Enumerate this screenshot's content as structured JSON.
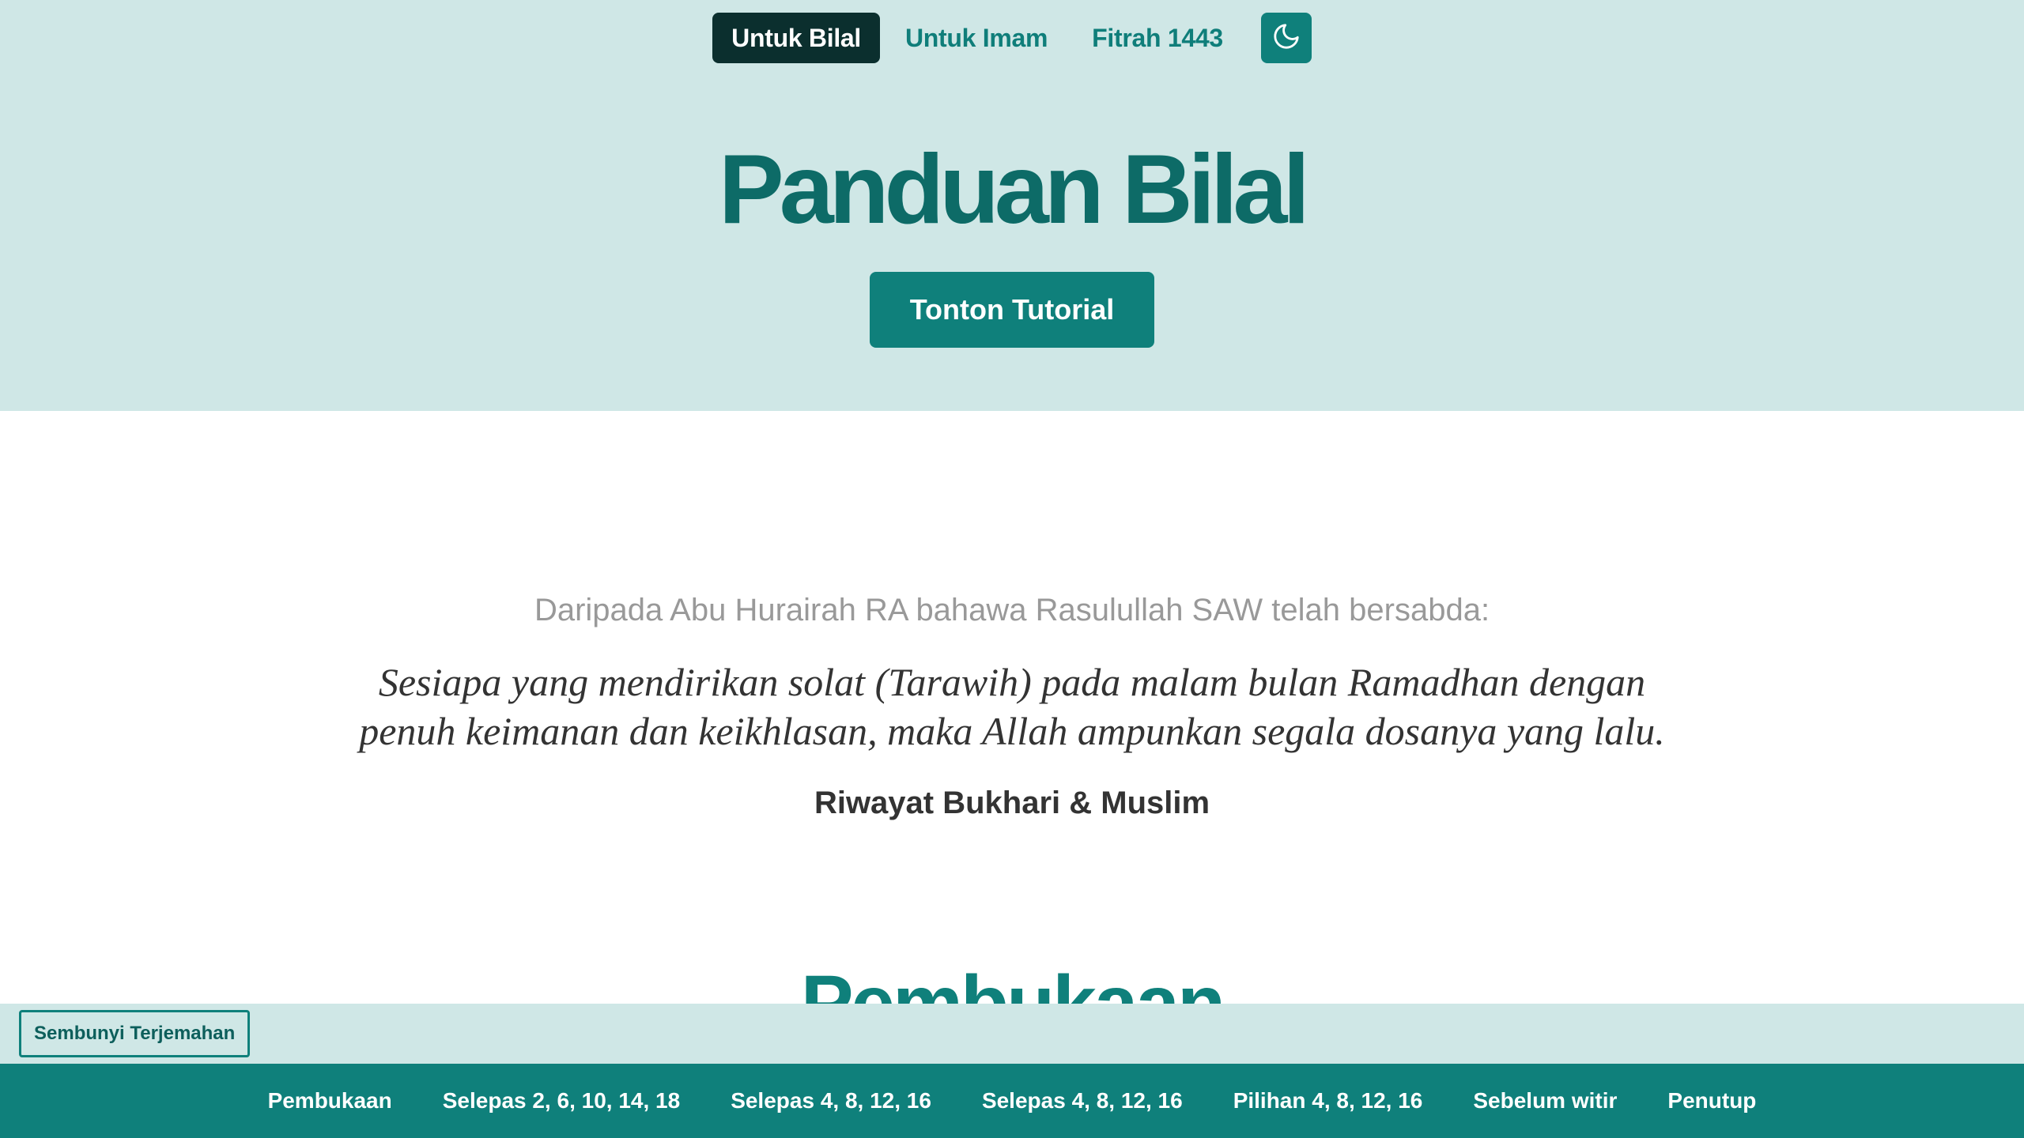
{
  "topnav": {
    "items": [
      {
        "label": "Untuk Bilal",
        "active": true
      },
      {
        "label": "Untuk Imam",
        "active": false
      },
      {
        "label": "Fitrah 1443",
        "active": false
      }
    ],
    "theme_toggle_icon": "moon-icon"
  },
  "hero": {
    "title": "Panduan Bilal",
    "tutorial_button": "Tonton Tutorial"
  },
  "quote": {
    "intro": "Daripada Abu Hurairah RA bahawa Rasulullah SAW telah bersabda:",
    "line1": "Sesiapa yang mendirikan solat (Tarawih) pada malam bulan Ramadhan dengan",
    "line2": "penuh keimanan dan keikhlasan, maka Allah ampunkan segala dosanya yang lalu.",
    "source": "Riwayat Bukhari & Muslim"
  },
  "section": {
    "heading": "Pembukaan"
  },
  "translation_bar": {
    "toggle_label": "Sembunyi Terjemahan"
  },
  "bottom_nav": {
    "items": [
      "Pembukaan",
      "Selepas 2, 6, 10, 14, 18",
      "Selepas 4, 8, 12, 16",
      "Selepas 4, 8, 12, 16",
      "Pilihan 4, 8, 12, 16",
      "Sebelum witir",
      "Penutup"
    ]
  },
  "colors": {
    "hero_bg": "#cfe7e6",
    "accent": "#0f807b",
    "active_nav_bg": "#0b2f2e",
    "title": "#0d6b67"
  }
}
